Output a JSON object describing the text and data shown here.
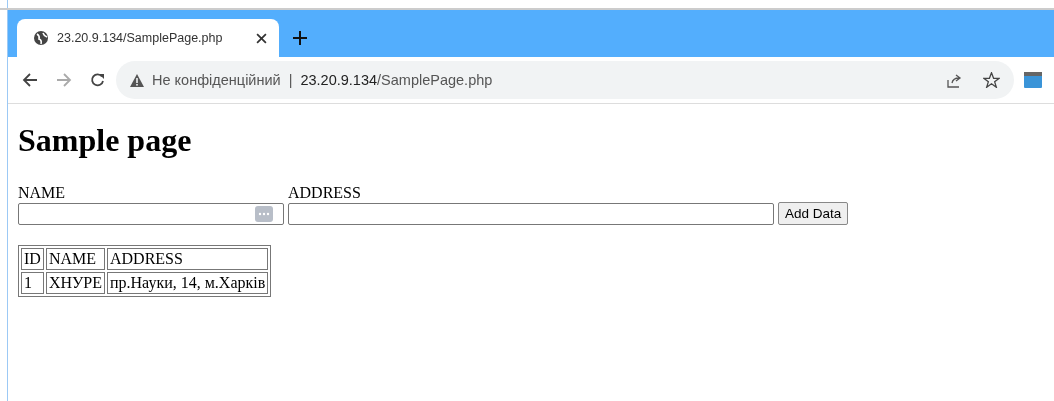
{
  "tab": {
    "title": "23.20.9.134/SamplePage.php",
    "selected": true
  },
  "toolbar": {
    "security": "Не конфіденційний",
    "separator": "|",
    "url_host": "23.20.9.134",
    "url_path": "/SamplePage.php"
  },
  "page": {
    "heading": "Sample page",
    "fields": [
      {
        "label": "NAME",
        "kind": "name"
      },
      {
        "label": "ADDRESS",
        "kind": "address"
      }
    ],
    "button": "Add Data",
    "table": {
      "columns": [
        "ID",
        "NAME",
        "ADDRESS"
      ],
      "rows": [
        [
          "1",
          "ХНУРЕ",
          "пр.Науки, 14, м.Харків"
        ]
      ]
    }
  }
}
